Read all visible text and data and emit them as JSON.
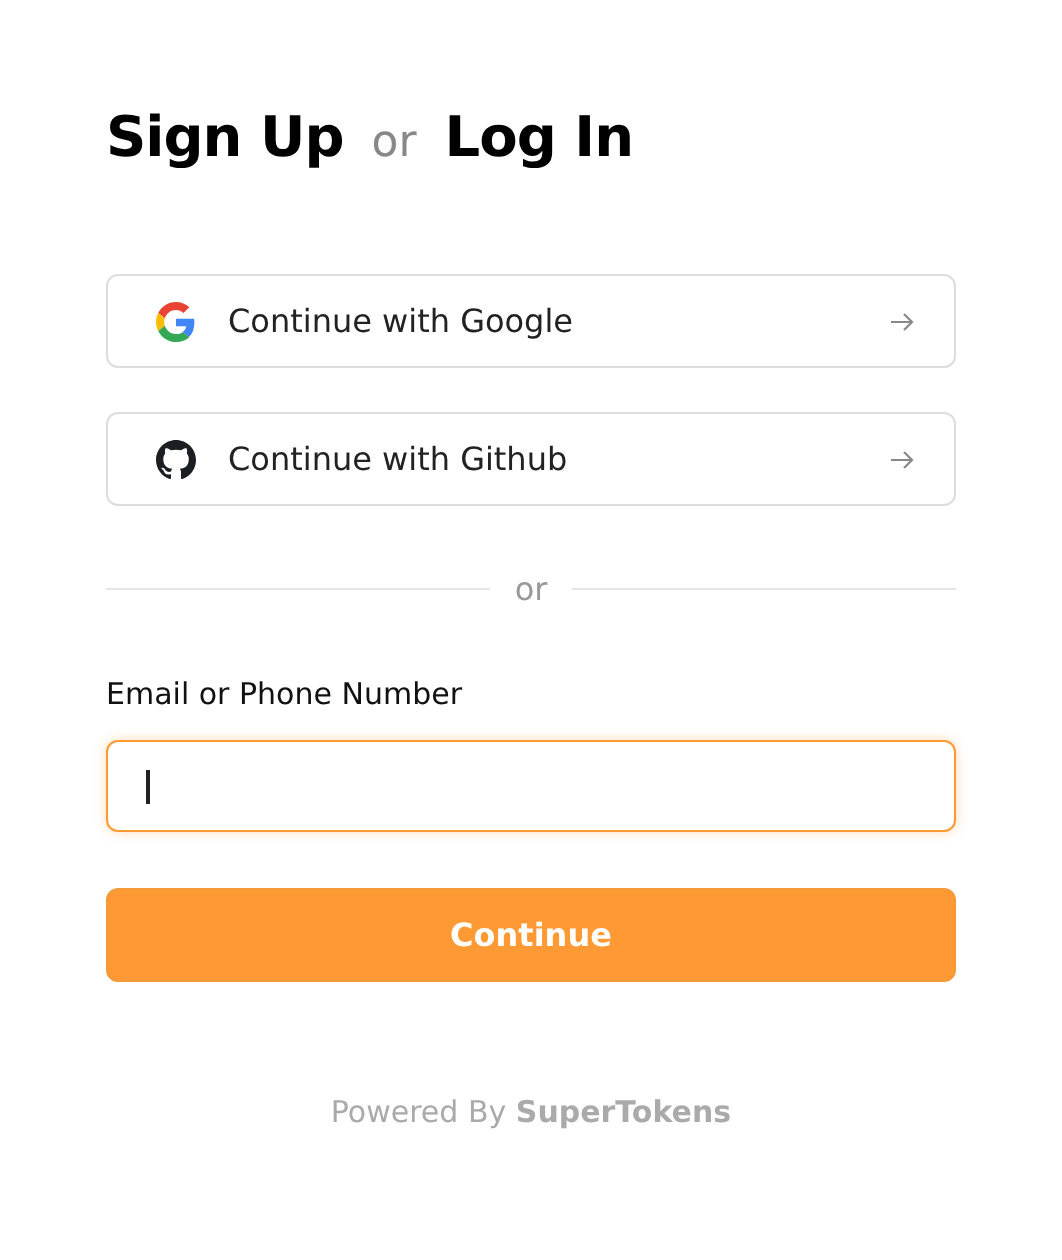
{
  "heading": {
    "primary": "Sign Up",
    "separator": "or",
    "secondary": "Log In"
  },
  "providers": [
    {
      "kind": "google",
      "label": "Continue with Google"
    },
    {
      "kind": "github",
      "label": "Continue with Github"
    }
  ],
  "divider": "or",
  "email_field": {
    "label": "Email or Phone Number",
    "focused": true
  },
  "submit_button": "Continue",
  "footer": "Powered By **SuperTokens**"
}
